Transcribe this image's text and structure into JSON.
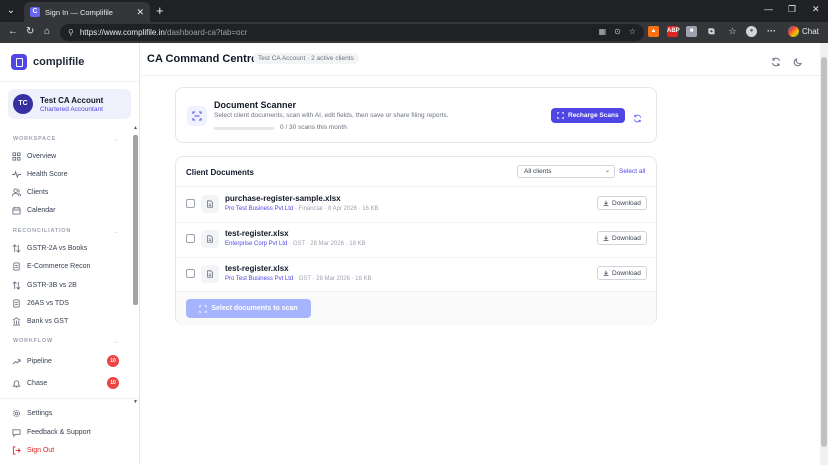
{
  "browser": {
    "tab_title": "Sign In — Complifile",
    "tab_favicon": "C",
    "url_host": "https://www.complifile.in",
    "url_path": "/dashboard-ca?tab=ocr",
    "chat_label": "Chat"
  },
  "sidebar": {
    "brand": "complifile",
    "user": {
      "initials": "TC",
      "name": "Test CA Account",
      "role": "Chartered Accountant"
    },
    "sections": {
      "workspace": "WORKSPACE",
      "reconciliation": "RECONCILIATION",
      "workflow": "WORKFLOW"
    },
    "items": {
      "overview": "Overview",
      "health": "Health Score",
      "clients": "Clients",
      "calendar": "Calendar",
      "gstr2a": "GSTR-2A vs Books",
      "ecom": "E-Commerce Recon",
      "gstr3b": "GSTR-3B vs 2B",
      "tds": "26AS vs TDS",
      "bank": "Bank vs GST",
      "pipeline": "Pipeline",
      "chase": "Chase",
      "settings": "Settings",
      "feedback": "Feedback & Support",
      "signout": "Sign Out"
    },
    "badges": {
      "pipeline": "10",
      "chase": "10"
    }
  },
  "header": {
    "title": "CA Command Centre",
    "pill": "Test CA Account · 2 active clients"
  },
  "scanner": {
    "title": "Document Scanner",
    "description": "Select client documents, scan with AI, edit fields, then save or share filing reports.",
    "progress_text": "0 / 30 scans this month",
    "progress_fraction": 0,
    "recharge_label": "Recharge Scans"
  },
  "documents": {
    "title": "Client Documents",
    "filter_value": "All clients",
    "select_all": "Select all",
    "download_label": "Download",
    "scan_button": "Select documents to scan",
    "rows": [
      {
        "name": "purchase-register-sample.xlsx",
        "client": "Pro Test Business Pvt Ltd",
        "meta": " · Financial · 8 Apr 2026 · 16 KB"
      },
      {
        "name": "test-register.xlsx",
        "client": "Enterprise Corp Pvt Ltd",
        "meta": " · GST · 28 Mar 2026 · 18 KB"
      },
      {
        "name": "test-register.xlsx",
        "client": "Pro Test Business Pvt Ltd",
        "meta": " · GST · 28 Mar 2026 · 18 KB"
      }
    ]
  },
  "colors": {
    "accent": "#4f46e5",
    "badge": "#ef4444",
    "danger": "#dc2626"
  }
}
